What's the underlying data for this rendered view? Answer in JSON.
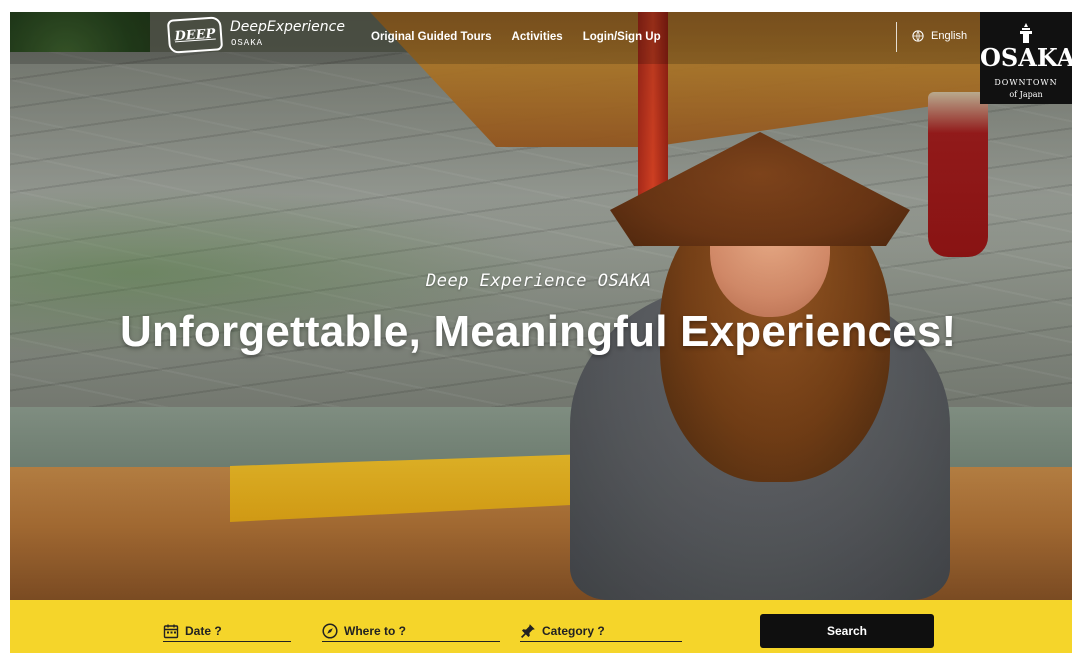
{
  "header": {
    "logo_mark": "DEEP",
    "brand_name": "DeepExperience",
    "brand_sub": "OSAKA",
    "nav": [
      {
        "label": "Original Guided Tours"
      },
      {
        "label": "Activities"
      },
      {
        "label": "Login/Sign Up"
      }
    ],
    "language": "English",
    "osaka_badge": {
      "title": "OSAKA",
      "line1": "DOWNTOWN",
      "line2": "of Japan"
    }
  },
  "hero": {
    "kicker": "Deep Experience OSAKA",
    "title": "Unforgettable, Meaningful Experiences!"
  },
  "search": {
    "date_label": "Date ?",
    "where_label": "Where to ?",
    "category_label": "Category ?",
    "button_label": "Search"
  },
  "colors": {
    "accent_yellow": "#f5d52a",
    "button_black": "#0f0f0f"
  },
  "icons": {
    "logo": "deep-logo-icon",
    "language": "globe-icon",
    "date": "calendar-icon",
    "where": "compass-icon",
    "category": "pin-icon",
    "badge": "osaka-castle-icon"
  }
}
